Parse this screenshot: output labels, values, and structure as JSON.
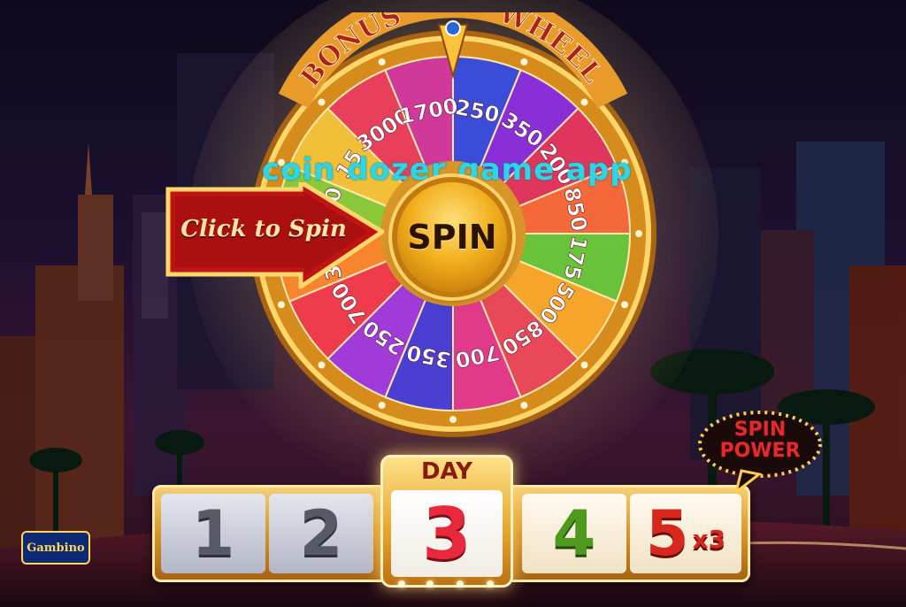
{
  "wheel": {
    "title_left": "BONUS",
    "title_right": "WHEEL",
    "spin_label": "SPIN",
    "segments": [
      {
        "value": "250",
        "color": "#3b4dd8"
      },
      {
        "value": "350",
        "color": "#8a2fd8"
      },
      {
        "value": "200",
        "color": "#e0365e"
      },
      {
        "value": "850",
        "color": "#f4683a"
      },
      {
        "value": "175",
        "color": "#68c23a"
      },
      {
        "value": "500",
        "color": "#f6a52a"
      },
      {
        "value": "850",
        "color": "#e84858"
      },
      {
        "value": "700",
        "color": "#e23a8a"
      },
      {
        "value": "350",
        "color": "#4a3fd0"
      },
      {
        "value": "250",
        "color": "#a03ad8"
      },
      {
        "value": "700",
        "color": "#ef3c4c"
      },
      {
        "value": "300",
        "color": "#f7852e"
      },
      {
        "value": "500",
        "color": "#8ac83a"
      },
      {
        "value": "15",
        "color": "#f2c038"
      },
      {
        "value": "3000",
        "color": "#e8405a"
      },
      {
        "value": "1700",
        "color": "#d0389a"
      }
    ]
  },
  "click_to_spin": "Click to Spin",
  "watermark": "coin dozer game app",
  "day_tracker": {
    "day_label": "DAY",
    "days": [
      "1",
      "2",
      "3",
      "4",
      "5"
    ],
    "multiplier": "x3",
    "current_day": 3
  },
  "spin_power": {
    "line1": "SPIN",
    "line2": "POWER"
  },
  "logo": "Gambino",
  "colors": {
    "gold": "#f2b01e",
    "current_day": "#e8283c",
    "day4": "#4f9a1e",
    "day5": "#d8281e"
  }
}
